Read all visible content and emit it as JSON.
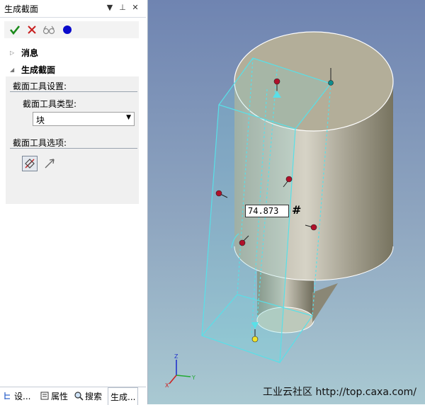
{
  "panel": {
    "title": "生成截面",
    "controls": {
      "dropdown": "▼",
      "pin": "⊥",
      "close": "✕"
    },
    "tree": {
      "messages": "消息",
      "generate_section": "生成截面"
    },
    "settings_group": "截面工具设置:",
    "type_label": "截面工具类型:",
    "type_value": "块",
    "options_group": "截面工具选项:"
  },
  "tabs": [
    {
      "label": "设...",
      "icon": "tree-icon"
    },
    {
      "label": "属性",
      "icon": "properties-icon"
    },
    {
      "label": "搜索",
      "icon": "search-icon"
    },
    {
      "label": "生成..."
    }
  ],
  "viewport": {
    "dimension_value": "74.873",
    "hash_symbol": "#",
    "watermark": "工业云社区 http://top.caxa.com/",
    "axes": {
      "x": "X",
      "y": "Y",
      "z": "Z"
    }
  },
  "colors": {
    "accent": "#0a0acb",
    "ok": "#1a8a1a",
    "cancel": "#c81e1e",
    "handle": "#b0102a",
    "section_edge": "#58e0e8"
  }
}
